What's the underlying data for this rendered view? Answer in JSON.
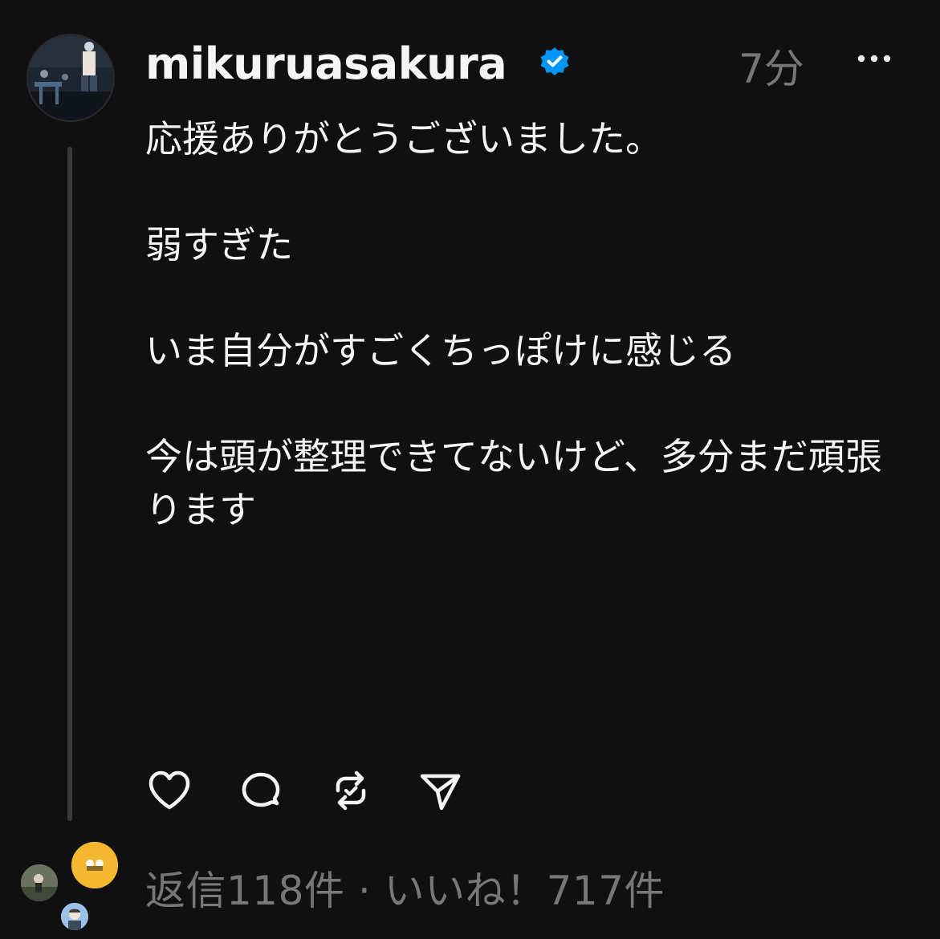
{
  "post": {
    "username": "mikuruasakura",
    "timestamp": "7分",
    "paragraphs": [
      "応援ありがとうございました。",
      "弱すぎた",
      "いま自分がすごくちっぽけに感じる",
      "今は頭が整理できてないけど、多分まだ頑張ります"
    ],
    "stats": "返信118件 · いいね！717件"
  },
  "icons": {
    "verified": "verified-badge-icon",
    "more": "more-options-icon",
    "like": "heart-icon",
    "comment": "comment-bubble-icon",
    "repost": "repost-icon",
    "share": "send-icon"
  },
  "colors": {
    "background": "#101010",
    "text": "#f3f5f7",
    "muted": "#777777",
    "verified": "#0095f6",
    "thread_line": "#3a3a3a"
  }
}
